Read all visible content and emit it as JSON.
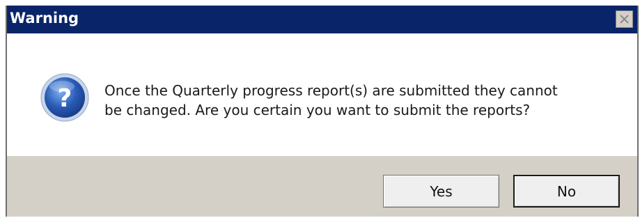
{
  "dialog": {
    "title": "Warning",
    "close_icon": "close-icon",
    "icon": "question-icon",
    "message_line1": "Once the Quarterly progress report(s) are submitted they cannot",
    "message_line2": "be changed. Are you certain you want to submit the reports?",
    "buttons": {
      "yes_label": "Yes",
      "no_label": "No"
    },
    "colors": {
      "titlebar": "#0a246a",
      "footer": "#d4d0c8",
      "icon_blue": "#2a5cb8"
    }
  }
}
